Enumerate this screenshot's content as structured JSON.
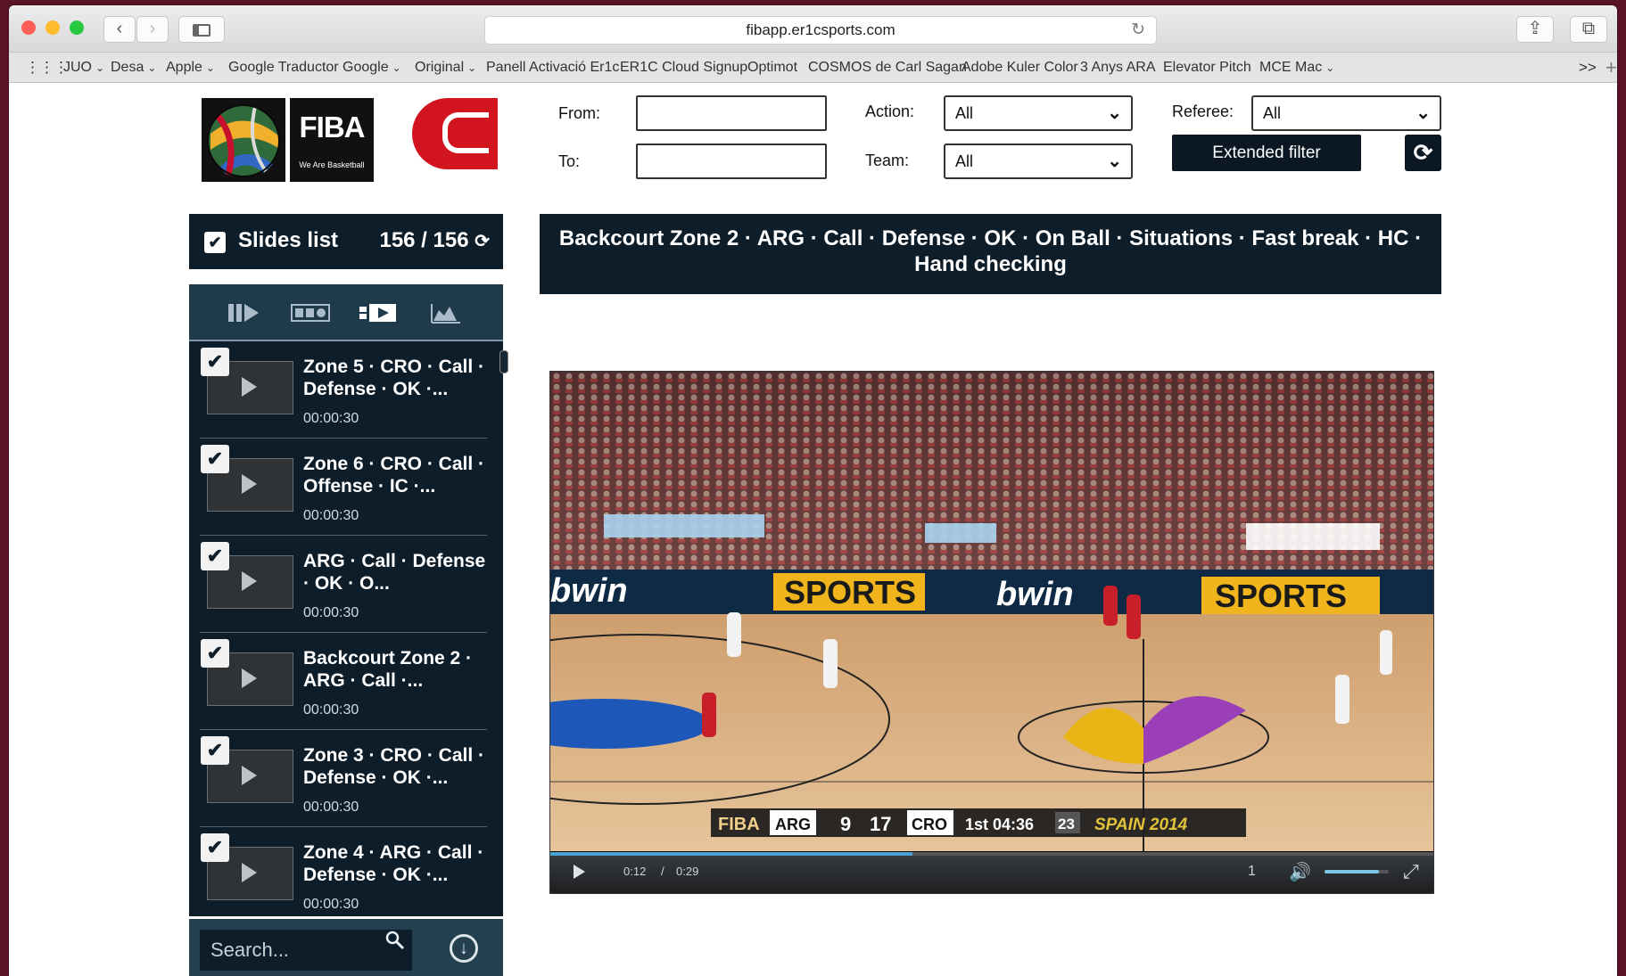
{
  "browser": {
    "url": "fibapp.er1csports.com",
    "colors": {
      "close": "#fd5e57",
      "minimize": "#febc2e",
      "zoom": "#28c840"
    },
    "bookmarks": [
      {
        "label": "JUO",
        "dropdown": true
      },
      {
        "label": "Desa",
        "dropdown": true
      },
      {
        "label": "Apple",
        "dropdown": true
      },
      {
        "label": "Google Traductor",
        "dropdown": false
      },
      {
        "label": "Google",
        "dropdown": true
      },
      {
        "label": "Original",
        "dropdown": true
      },
      {
        "label": "Panell Activació Er1c",
        "dropdown": false
      },
      {
        "label": "ER1C Cloud Signup",
        "dropdown": false
      },
      {
        "label": "Optimot",
        "dropdown": false
      },
      {
        "label": "COSMOS de Carl Sagan",
        "dropdown": false
      },
      {
        "label": "Adobe Kuler Color",
        "dropdown": false
      },
      {
        "label": "3 Anys ARA",
        "dropdown": false
      },
      {
        "label": "Elevator Pitch",
        "dropdown": false
      },
      {
        "label": "MCE Mac",
        "dropdown": true
      }
    ],
    "overflow_label": ">>"
  },
  "logos": {
    "fiba_text": "FIBA",
    "fiba_tagline": "We Are Basketball"
  },
  "filters": {
    "from_label": "From:",
    "to_label": "To:",
    "action_label": "Action:",
    "action_value": "All",
    "team_label": "Team:",
    "team_value": "All",
    "referee_label": "Referee:",
    "referee_value": "All",
    "extended_filter_label": "Extended filter"
  },
  "slides": {
    "title": "Slides list",
    "count": "156 / 156",
    "items": [
      {
        "text": "Zone 5 · CRO · Call · Defense · OK ·...",
        "duration": "00:00:30"
      },
      {
        "text": "Zone 6 · CRO · Call · Offense · IC ·...",
        "duration": "00:00:30"
      },
      {
        "text": "ARG · Call · Defense · OK · O...",
        "duration": "00:00:30"
      },
      {
        "text": "Backcourt Zone 2 · ARG · Call ·...",
        "duration": "00:00:30"
      },
      {
        "text": "Zone 3 · CRO · Call · Defense · OK ·...",
        "duration": "00:00:30"
      },
      {
        "text": "Zone 4 · ARG · Call · Defense · OK ·...",
        "duration": "00:00:30"
      }
    ]
  },
  "search": {
    "placeholder": "Search..."
  },
  "clip_title": "Backcourt Zone 2 · ARG · Call · Defense · OK · On Ball · Situations · Fast break · HC · Hand checking",
  "video": {
    "scoreboard": {
      "brand": "FIBA",
      "team1": "ARG",
      "score1": "9",
      "score2": "17",
      "team2": "CRO",
      "period_clock": "1st 04:36",
      "shot_clock": "23",
      "event": "SPAIN 2014"
    },
    "arena_ads": [
      "bwin",
      "SPORTS",
      "bwin",
      "SPORTS"
    ],
    "current_time": "0:12",
    "separator": "/",
    "duration": "0:29",
    "progress": 0.41,
    "speed": "1",
    "volume": 0.85
  }
}
